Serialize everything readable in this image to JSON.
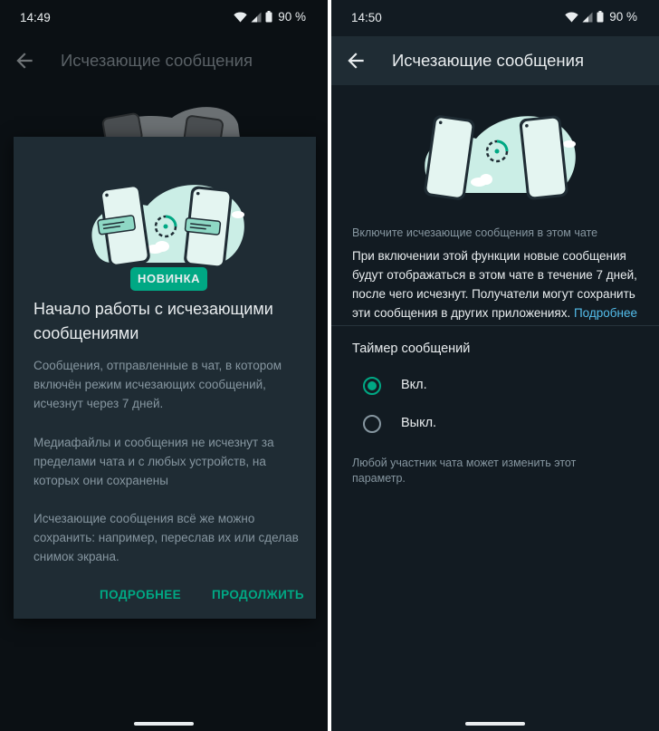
{
  "left": {
    "status": {
      "time": "14:49",
      "battery": "90 %"
    },
    "appbar": {
      "title": "Исчезающие сообщения"
    },
    "dialog": {
      "badge": "НОВИНКА",
      "heading": "Начало работы с исчезающими сообщениями",
      "para1": "Сообщения, отправленные в чат, в котором включён режим исчезающих сообщений, исчезнут через 7 дней.",
      "para2": "Медиафайлы и сообщения не исчезнут за пределами чата и с любых устройств, на которых они сохранены",
      "para3": "Исчезающие сообщения всё же можно сохранить: например, переслав их или сделав снимок экрана.",
      "learn_more": "ПОДРОБНЕЕ",
      "continue": "ПРОДОЛЖИТЬ"
    }
  },
  "right": {
    "status": {
      "time": "14:50",
      "battery": "90 %"
    },
    "appbar": {
      "title": "Исчезающие сообщения"
    },
    "section_title": "Включите исчезающие сообщения в этом чате",
    "description": "При включении этой функции новые сообщения будут отображаться в этом чате в течение 7 дней, после чего исчезнут. Получатели могут сохранить эти сообщения в других приложениях.",
    "learn_more_link": "Подробнее",
    "timer_title": "Таймер сообщений",
    "options": [
      {
        "label": "Вкл.",
        "selected": true
      },
      {
        "label": "Выкл.",
        "selected": false
      }
    ],
    "footnote": "Любой участник чата может изменить этот параметр."
  },
  "colors": {
    "accent": "#00a884",
    "link": "#53bdeb",
    "dialog_bg": "#1f2c34",
    "screen_bg": "#121b22"
  }
}
